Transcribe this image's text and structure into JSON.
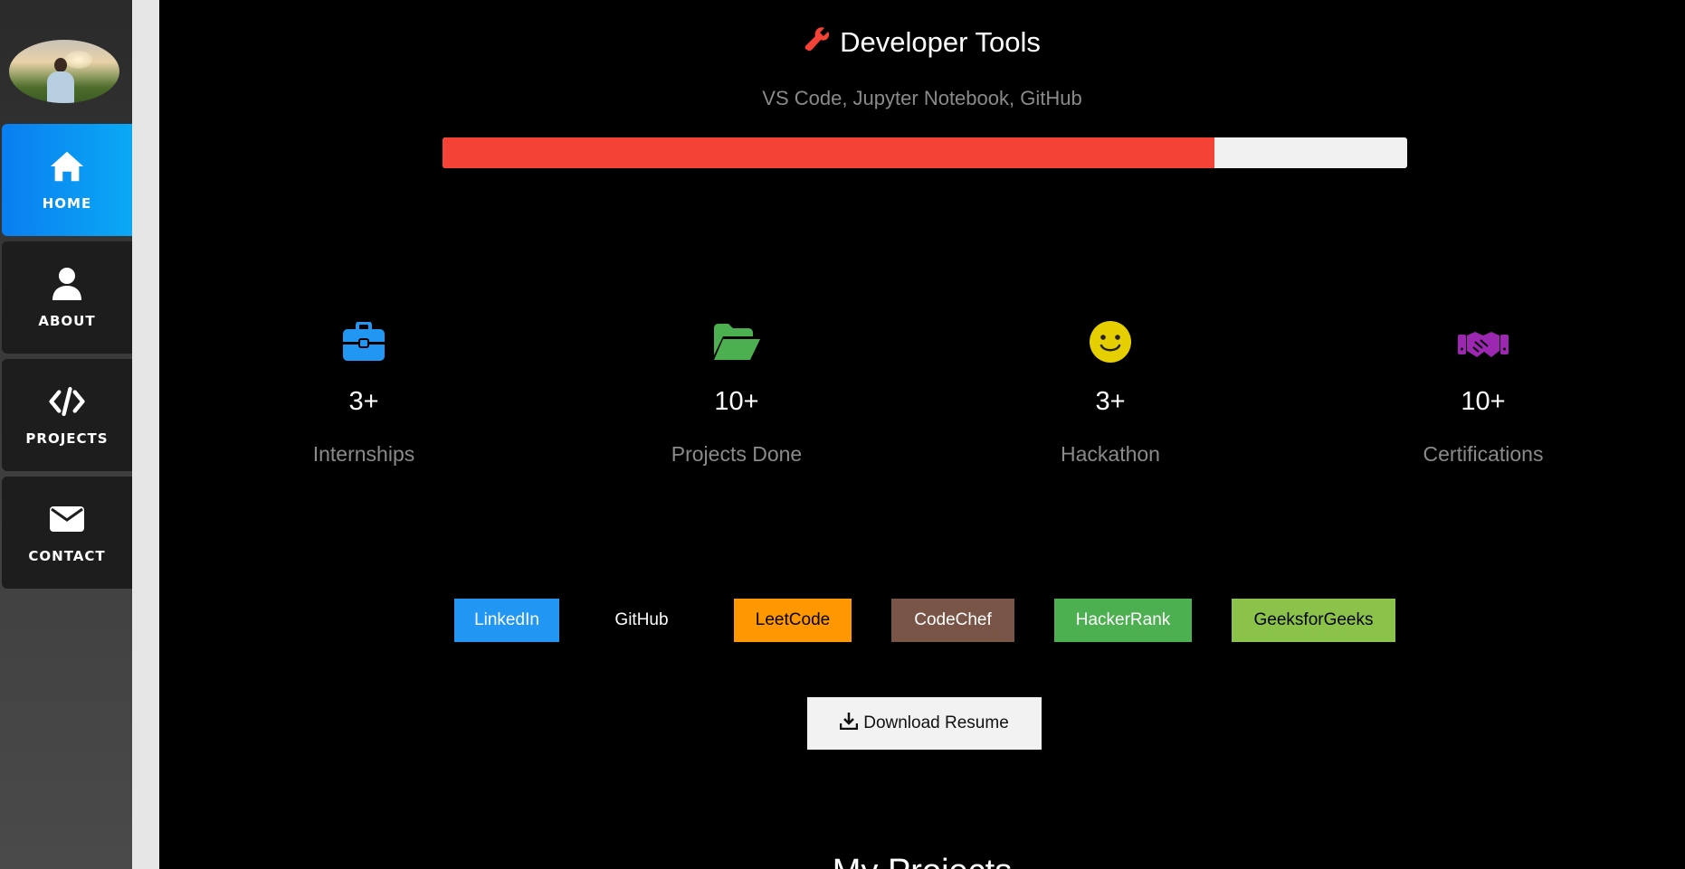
{
  "sidebar": {
    "items": [
      {
        "label": "HOME",
        "icon": "home-icon",
        "active": true
      },
      {
        "label": "ABOUT",
        "icon": "user-icon",
        "active": false
      },
      {
        "label": "PROJECTS",
        "icon": "code-icon",
        "active": false
      },
      {
        "label": "CONTACT",
        "icon": "envelope-icon",
        "active": false
      }
    ]
  },
  "skill": {
    "title": "Developer Tools",
    "icon": "wrench-icon",
    "subtitle": "VS Code, Jupyter Notebook, GitHub",
    "progress_percent": 80
  },
  "stats": [
    {
      "value": "3+",
      "label": "Internships",
      "icon": "briefcase-icon",
      "color": "#2196f3"
    },
    {
      "value": "10+",
      "label": "Projects Done",
      "icon": "folder-open-icon",
      "color": "#4caf50"
    },
    {
      "value": "3+",
      "label": "Hackathon",
      "icon": "smile-icon",
      "color": "#e6cf00"
    },
    {
      "value": "10+",
      "label": "Certifications",
      "icon": "handshake-icon",
      "color": "#9c27b0"
    }
  ],
  "links": [
    {
      "label": "LinkedIn",
      "bg": "#2196f3",
      "fg": "#ffffff"
    },
    {
      "label": "GitHub",
      "bg": "#000000",
      "fg": "#ffffff"
    },
    {
      "label": "LeetCode",
      "bg": "#ff9800",
      "fg": "#000000"
    },
    {
      "label": "CodeChef",
      "bg": "#795548",
      "fg": "#ffffff"
    },
    {
      "label": "HackerRank",
      "bg": "#4caf50",
      "fg": "#ffffff"
    },
    {
      "label": "GeeksforGeeks",
      "bg": "#8bc34a",
      "fg": "#000000"
    }
  ],
  "download": {
    "label": "Download Resume",
    "icon": "download-icon"
  },
  "next_section": {
    "heading": "My Projects"
  },
  "colors": {
    "accent": "#0a9af5",
    "progress": "#f44336"
  }
}
